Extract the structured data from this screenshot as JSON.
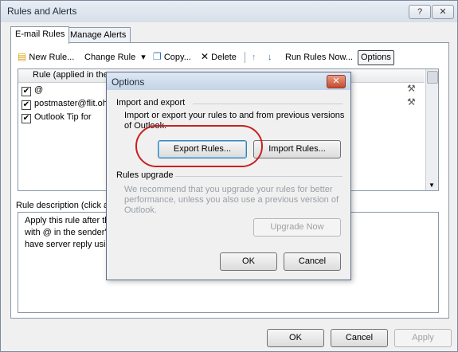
{
  "window": {
    "title": "Rules and Alerts",
    "help_btn": "?",
    "close_btn": "✕"
  },
  "tabs": [
    "E-mail Rules",
    "Manage Alerts"
  ],
  "toolbar": {
    "new_rule": "New Rule...",
    "change_rule": "Change Rule",
    "dropdown_arrow": "▾",
    "copy": "Copy...",
    "delete": "Delete",
    "move_up": "↑",
    "move_down": "↓",
    "run_rules": "Run Rules Now...",
    "options": "Options"
  },
  "rules_list": {
    "column_header": "Rule (applied in the",
    "rows": [
      {
        "text": "@"
      },
      {
        "text": "postmaster@flit.oh"
      },
      {
        "text": "Outlook Tip for"
      }
    ]
  },
  "description": {
    "label": "Rule description (click an",
    "lines": [
      "Apply this rule after th",
      "with @ in the sender's",
      "have server reply usin"
    ]
  },
  "footer": {
    "ok": "OK",
    "cancel": "Cancel",
    "apply": "Apply"
  },
  "options_dialog": {
    "title": "Options",
    "close": "✕",
    "import_export_title": "Import and export",
    "import_export_text": [
      "Import or export your rules to and from previous versions",
      "of Outlook."
    ],
    "export_btn": "Export Rules...",
    "import_btn": "Import Rules...",
    "upgrade_title": "Rules upgrade",
    "upgrade_text": [
      "We recommend that you upgrade your rules for better",
      "performance, unless you also use a previous version of",
      "Outlook."
    ],
    "upgrade_btn": "Upgrade Now",
    "ok": "OK",
    "cancel": "Cancel"
  }
}
